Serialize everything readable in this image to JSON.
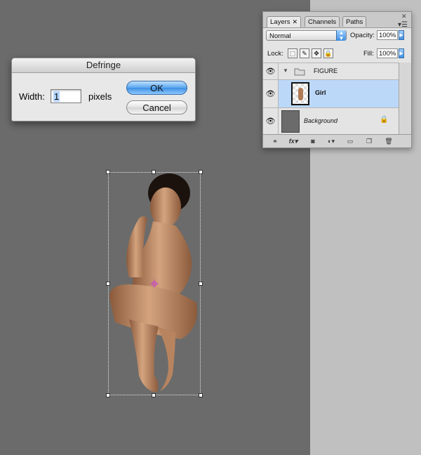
{
  "dialog": {
    "title": "Defringe",
    "width_label": "Width:",
    "width_value": "1",
    "units_label": "pixels",
    "ok_label": "OK",
    "cancel_label": "Cancel"
  },
  "layers_panel": {
    "tabs": [
      {
        "label": "Layers",
        "active": true
      },
      {
        "label": "Channels",
        "active": false
      },
      {
        "label": "Paths",
        "active": false
      }
    ],
    "blend_mode": "Normal",
    "opacity_label": "Opacity:",
    "opacity_value": "100%",
    "lock_label": "Lock:",
    "fill_label": "Fill:",
    "fill_value": "100%",
    "layers": [
      {
        "name": "FIGURE",
        "type": "group",
        "visible": true,
        "selected": false
      },
      {
        "name": "Girl",
        "type": "layer",
        "visible": true,
        "selected": true
      },
      {
        "name": "Background",
        "type": "background",
        "visible": true,
        "selected": false,
        "locked": true
      }
    ],
    "footer_icons": [
      "link-layers-icon",
      "fx-icon",
      "mask-icon",
      "adjustment-icon",
      "new-group-icon",
      "new-layer-icon",
      "trash-icon"
    ],
    "footer_fx_label": "fx"
  },
  "colors": {
    "canvas_bg": "#6b6b6b",
    "selection_highlight": "#bcd8f8",
    "ok_button": "#3d8fe3"
  }
}
